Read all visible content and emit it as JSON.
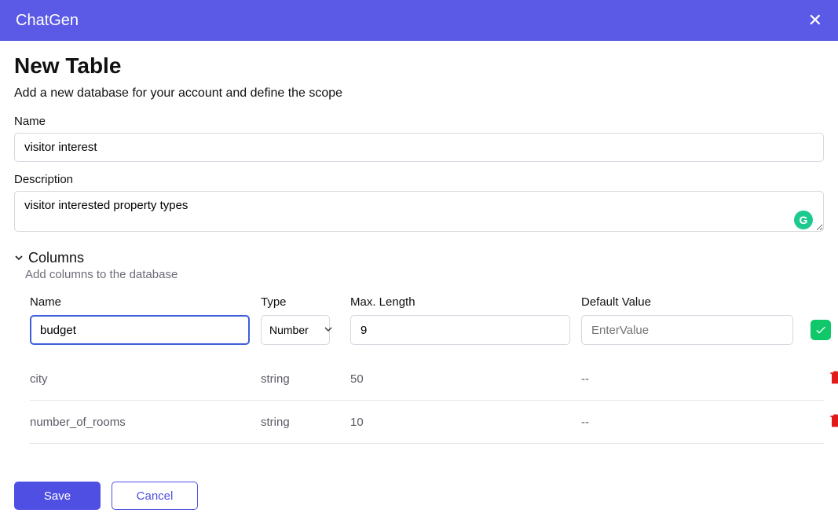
{
  "app": {
    "name": "ChatGen"
  },
  "page": {
    "title": "New Table",
    "subtitle": "Add a new database for your account and define the scope"
  },
  "fields": {
    "name_label": "Name",
    "name_value": "visitor interest",
    "desc_label": "Description",
    "desc_value": "visitor interested property types"
  },
  "columns_section": {
    "heading": "Columns",
    "subtitle": "Add columns to the database",
    "headers": {
      "name": "Name",
      "type": "Type",
      "max_length": "Max. Length",
      "default_value": "Default Value"
    },
    "draft": {
      "name": "budget",
      "type": "Number",
      "max_length": "9",
      "default_value": "",
      "default_placeholder": "EnterValue"
    },
    "rows": [
      {
        "name": "city",
        "type": "string",
        "max_length": "50",
        "default_value": "--"
      },
      {
        "name": "number_of_rooms",
        "type": "string",
        "max_length": "10",
        "default_value": "--"
      }
    ]
  },
  "footer": {
    "save": "Save",
    "cancel": "Cancel"
  }
}
